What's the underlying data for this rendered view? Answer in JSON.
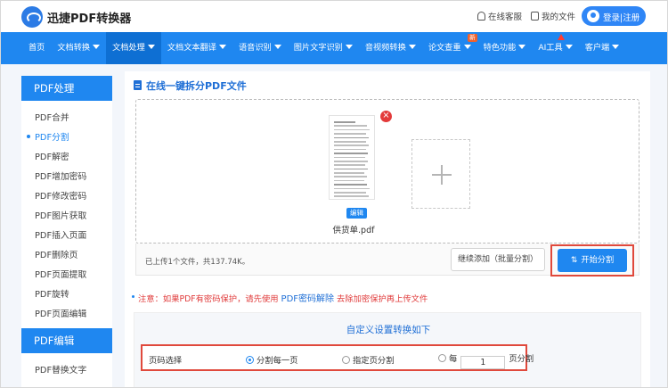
{
  "header": {
    "brand": "迅捷PDF转换器",
    "service_label": "在线客服",
    "my_files_label": "我的文件",
    "login_label": "登录|注册"
  },
  "nav": {
    "items": [
      {
        "label": "首页",
        "caret": false
      },
      {
        "label": "文档转换",
        "caret": true
      },
      {
        "label": "文档处理",
        "caret": true,
        "active": true
      },
      {
        "label": "文档文本翻译",
        "caret": true
      },
      {
        "label": "语音识别",
        "caret": true
      },
      {
        "label": "图片文字识别",
        "caret": true
      },
      {
        "label": "音视频转换",
        "caret": true
      },
      {
        "label": "论文查重",
        "caret": true,
        "badge": "新"
      },
      {
        "label": "特色功能",
        "caret": true
      },
      {
        "label": "AI工具",
        "caret": true,
        "hot": true
      },
      {
        "label": "客户端",
        "caret": true
      }
    ]
  },
  "sidebar": {
    "section1_title": "PDF处理",
    "section1_items": [
      "PDF合并",
      "PDF分割",
      "PDF解密",
      "PDF增加密码",
      "PDF修改密码",
      "PDF图片获取",
      "PDF插入页面",
      "PDF删除页",
      "PDF页面提取",
      "PDF旋转",
      "PDF页面编辑"
    ],
    "active_item": "PDF分割",
    "section2_title": "PDF编辑",
    "section2_items": [
      "PDF替换文字"
    ]
  },
  "main": {
    "title": "在线一键拆分PDF文件",
    "file": {
      "edit_label": "编辑",
      "name": "供货单.pdf"
    },
    "status_text": "已上传1个文件，共137.74K。",
    "continue_label": "继续添加（批量分割）",
    "start_label": "开始分割",
    "notice_prefix": "注意：如果PDF有密码保护，请先使用",
    "notice_link": "PDF密码解除",
    "notice_suffix": "去除加密保护再上传文件",
    "settings_title": "自定义设置转换如下",
    "page_select_label": "页码选择",
    "option1": "分割每一页",
    "option2": "指定页分割",
    "option3_prefix": "每",
    "option3_value": "1",
    "option3_suffix": "页分割"
  },
  "colors": {
    "brand_blue": "#1f87f0",
    "highlight_red": "#e0493c",
    "notice_red": "#e03b3b"
  }
}
